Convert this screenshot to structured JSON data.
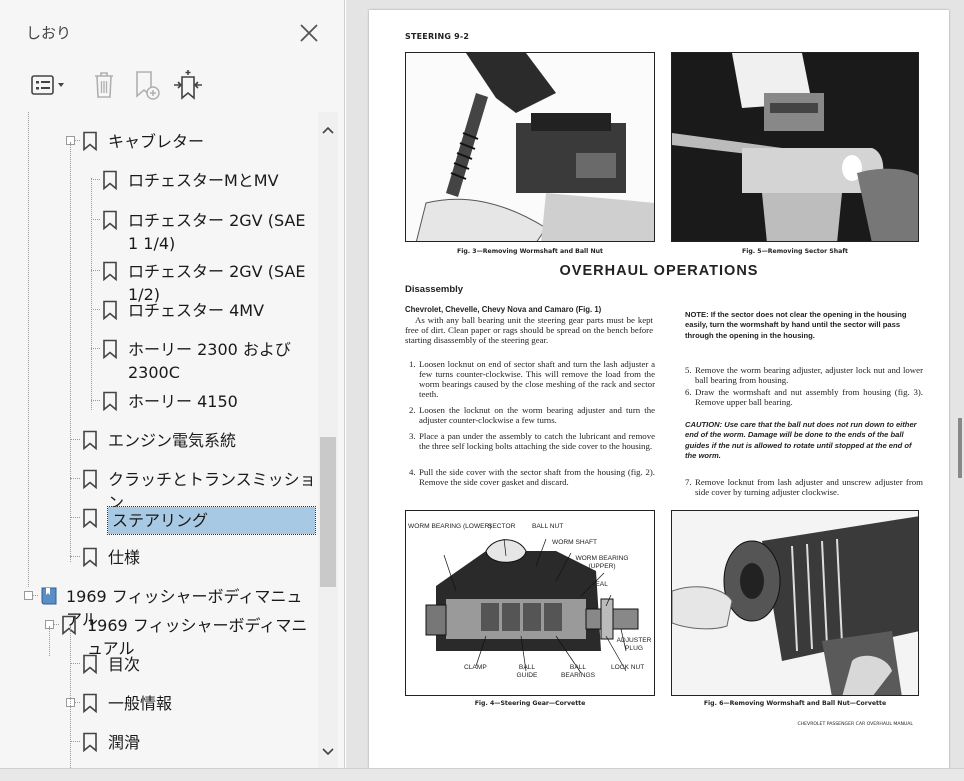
{
  "panel": {
    "title": "しおり",
    "close_icon": "close-icon",
    "toolbar": [
      "options-menu-icon",
      "delete-bookmark-icon",
      "new-bookmark-icon",
      "expand-bookmark-icon"
    ]
  },
  "bookmarks": [
    {
      "label": "キャブレター"
    },
    {
      "label": "ロチェスターMとMV"
    },
    {
      "label": "ロチェスター 2GV (SAE 1 1/4)"
    },
    {
      "label": "ロチェスター 2GV (SAE 1/2)"
    },
    {
      "label": "ロチェスター 4MV"
    },
    {
      "label": "ホーリー 2300 および 2300C"
    },
    {
      "label": "ホーリー 4150"
    },
    {
      "label": "エンジン電気系統"
    },
    {
      "label": "クラッチとトランスミッション"
    },
    {
      "label": "ステアリング"
    },
    {
      "label": "仕様"
    },
    {
      "label": "1969 フィッシャーボディマニュアル"
    },
    {
      "label": "1969 フィッシャーボディマニュアル"
    },
    {
      "label": "目次"
    },
    {
      "label": "一般情報"
    },
    {
      "label": "潤滑"
    }
  ],
  "document": {
    "header": "STEERING 9-2",
    "fig3": "Fig. 3—Removing Wormshaft and Ball Nut",
    "fig5": "Fig. 5—Removing Sector Shaft",
    "title": "OVERHAUL OPERATIONS",
    "section": "Disassembly",
    "subhead": "Chevrolet, Chevelle, Chevy Nova and Camaro (Fig. 1)",
    "intro": "As with any ball bearing unit the steering gear parts must be kept free of dirt. Clean paper or rags should be spread on the bench before starting disassembly of the steering gear.",
    "steps_left": [
      {
        "n": "1.",
        "text": "Loosen locknut on end of sector shaft and turn the lash adjuster a few turns counter-clockwise. This will remove the load from the worm bearings caused by the close meshing of the rack and sector teeth."
      },
      {
        "n": "2.",
        "text": "Loosen the locknut on the worm bearing adjuster and turn the adjuster counter-clockwise a few turns."
      },
      {
        "n": "3.",
        "text": "Place a pan under the assembly to catch the lubricant and remove the three self locking bolts attaching the side cover to the housing."
      },
      {
        "n": "4.",
        "text": "Pull the side cover with the sector shaft from the housing (fig. 2). Remove the side cover gasket and discard."
      }
    ],
    "note": "NOTE: If the sector does not clear the opening in the housing easily, turn the wormshaft by hand until the sector will pass through the opening in the housing.",
    "steps_right": [
      {
        "n": "5.",
        "text": "Remove the worm bearing adjuster, adjuster lock nut and lower ball bearing from housing."
      },
      {
        "n": "6.",
        "text": "Draw the wormshaft and nut assembly from housing (fig. 3). Remove upper ball bearing."
      },
      {
        "n": "7.",
        "text": "Remove locknut from lash adjuster and unscrew adjuster from side cover by turning adjuster clockwise."
      }
    ],
    "caution": "CAUTION: Use care that the ball nut does not run down to either end of the worm. Damage will be done to the ends of the ball guides if the nut is allowed to rotate until stopped at the end of the worm.",
    "diagram_labels": {
      "worm_bearing_lower": "WORM BEARING (LOWER)",
      "sector": "SECTOR",
      "ball_nut": "BALL NUT",
      "worm_shaft": "WORM SHAFT",
      "worm_bearing_upper": "WORM BEARING (UPPER)",
      "seal": "SEAL",
      "adjuster_plug": "ADJUSTER PLUG",
      "clamp": "CLAMP",
      "ball_guide": "BALL GUIDE",
      "ball_bearings": "BALL BEARINGS",
      "lock_nut": "LOCK NUT"
    },
    "fig4": "Fig. 4—Steering Gear—Corvette",
    "fig6": "Fig. 6—Removing Wormshaft and Ball Nut—Corvette",
    "footer": "CHEVROLET PASSENGER CAR OVERHAUL MANUAL"
  }
}
